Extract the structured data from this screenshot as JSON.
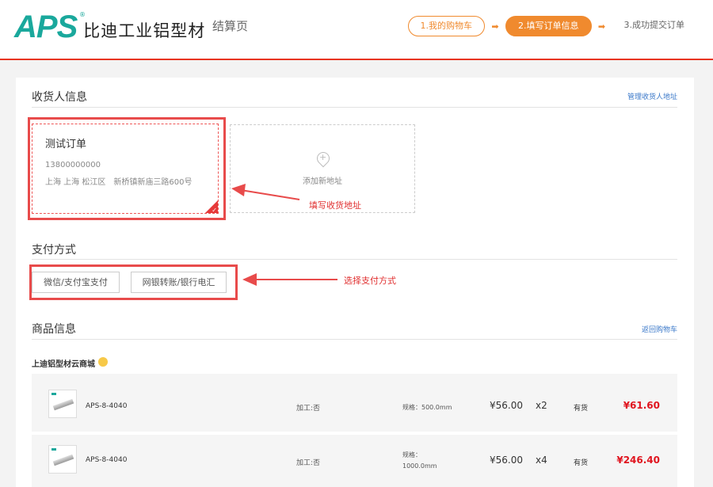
{
  "header": {
    "logo_mark": "APS",
    "logo_reg": "®",
    "logo_text": "比迪工业铝型材",
    "page_name": "结算页",
    "steps": [
      {
        "label": "1.我的购物车",
        "state": "done"
      },
      {
        "label": "2.填写订单信息",
        "state": "active"
      },
      {
        "label": "3.成功提交订单",
        "state": "todo"
      }
    ],
    "step_arrow": "➡"
  },
  "consignee": {
    "title": "收货人信息",
    "manage_link": "管理收货人地址",
    "selected_address": {
      "name": "测试订单",
      "phone": "13800000000",
      "address": "上海 上海 松江区　新桥镇新庙三路600号"
    },
    "add_new_label": "添加新地址"
  },
  "payment": {
    "title": "支付方式",
    "options": [
      "微信/支付宝支付",
      "网银转账/银行电汇"
    ]
  },
  "goods": {
    "title": "商品信息",
    "back_link": "返回购物车",
    "shop_name": "上迪铝型材云商城",
    "items": [
      {
        "code": "APS-8-4040",
        "processing": "加工:否",
        "spec": "规格：500.0mm",
        "price": "¥56.00",
        "qty": "x2",
        "stock": "有货",
        "total": "¥61.60"
      },
      {
        "code": "APS-8-4040",
        "processing": "加工:否",
        "spec_line1": "规格：",
        "spec_line2": "1000.0mm",
        "price": "¥56.00",
        "qty": "x4",
        "stock": "有货",
        "total": "¥246.40"
      }
    ]
  },
  "annotations": {
    "address_hint": "填写收货地址",
    "payment_hint": "选择支付方式",
    "color": "#e84b4b"
  },
  "colors": {
    "brand_teal": "#1aa89c",
    "accent_orange": "#f08a2e",
    "header_line": "#e8341f",
    "price_red": "#e0141e",
    "link_blue": "#3a78c9"
  }
}
